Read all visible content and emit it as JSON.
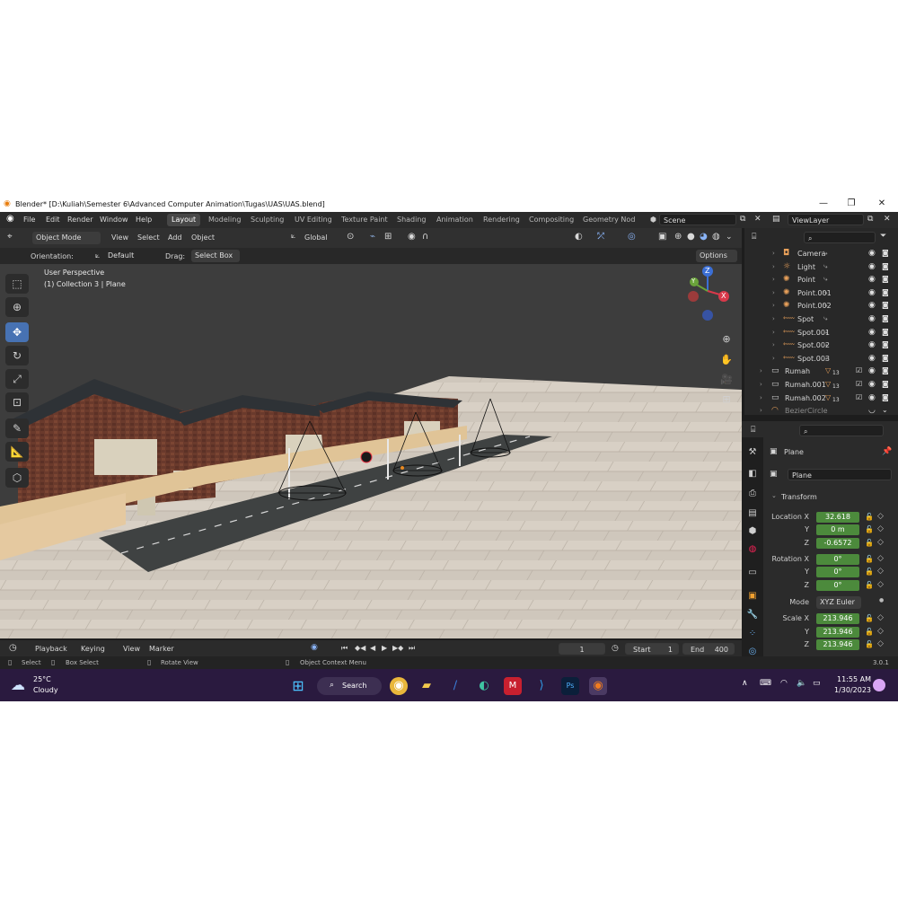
{
  "window": {
    "title": "Blender* [D:\\Kuliah\\Semester 6\\Advanced Computer Animation\\Tugas\\UAS\\UAS.blend]"
  },
  "menu": [
    "File",
    "Edit",
    "Render",
    "Window",
    "Help"
  ],
  "workspaces": [
    "Layout",
    "Modeling",
    "Sculpting",
    "UV Editing",
    "Texture Paint",
    "Shading",
    "Animation",
    "Rendering",
    "Compositing",
    "Geometry Nod"
  ],
  "scene": "Scene",
  "view_layer": "ViewLayer",
  "header": {
    "mode": "Object Mode",
    "menus": [
      "View",
      "Select",
      "Add",
      "Object"
    ],
    "transform_orientation": "Global"
  },
  "tool_options": {
    "orientation_label": "Orientation:",
    "orientation": "Default",
    "drag_label": "Drag:",
    "drag": "Select Box",
    "options": "Options"
  },
  "viewport": {
    "view_name": "User Perspective",
    "context": "(1) Collection 3 | Plane",
    "gizmo": {
      "x": "X",
      "y": "Y",
      "z": "Z"
    }
  },
  "outliner": {
    "rows": [
      {
        "name": "Camera",
        "icon": "camera-icon"
      },
      {
        "name": "Light",
        "icon": "light-icon"
      },
      {
        "name": "Point",
        "icon": "point-light-icon"
      },
      {
        "name": "Point.001",
        "icon": "point-light-icon"
      },
      {
        "name": "Point.002",
        "icon": "point-light-icon"
      },
      {
        "name": "Spot",
        "icon": "spot-light-icon"
      },
      {
        "name": "Spot.001",
        "icon": "spot-light-icon"
      },
      {
        "name": "Spot.002",
        "icon": "spot-light-icon"
      },
      {
        "name": "Spot.003",
        "icon": "spot-light-icon"
      },
      {
        "name": "Rumah",
        "icon": "collection-icon",
        "badge": "13"
      },
      {
        "name": "Rumah.001",
        "icon": "collection-icon",
        "badge": "13"
      },
      {
        "name": "Rumah.002",
        "icon": "collection-icon",
        "badge": "13"
      },
      {
        "name": "BezierCircle",
        "icon": "curve-icon"
      }
    ]
  },
  "properties": {
    "object_name": "Plane",
    "data_name": "Plane",
    "panel": "Transform",
    "location": {
      "label": "Location X",
      "x": "32.618",
      "y": "0 m",
      "z": "-0.6572"
    },
    "rotation": {
      "label": "Rotation X",
      "x": "0°",
      "y": "0°",
      "z": "0°"
    },
    "mode_label": "Mode",
    "mode": "XYZ Euler",
    "scale": {
      "label": "Scale X",
      "x": "213.946",
      "y": "213.946",
      "z": "213.946"
    },
    "axis_y": "Y",
    "axis_z": "Z"
  },
  "timeline": {
    "menus": [
      "Playback",
      "Keying",
      "View",
      "Marker"
    ],
    "current_frame": "1",
    "start_label": "Start",
    "start": "1",
    "end_label": "End",
    "end": "400"
  },
  "status_bar": {
    "select": "Select",
    "box_select": "Box Select",
    "rotate_view": "Rotate View",
    "context_menu": "Object Context Menu",
    "version": "3.0.1"
  },
  "taskbar": {
    "weather_temp": "25°C",
    "weather_desc": "Cloudy",
    "search": "Search",
    "time": "11:55 AM",
    "date": "1/30/2023"
  },
  "colors": {
    "accent": "#4772b3",
    "value_field": "#4c8a3c",
    "workspace_active": "#474747",
    "taskbar": "#2a1a3f"
  }
}
